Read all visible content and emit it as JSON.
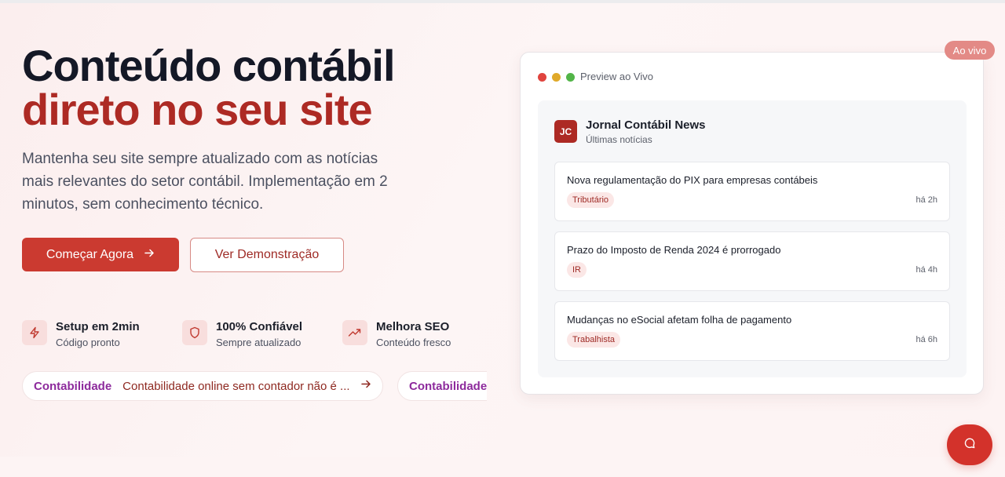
{
  "hero": {
    "title_line1": "Conteúdo contábil",
    "title_line2": "direto no seu site",
    "description": "Mantenha seu site sempre atualizado com as notícias mais relevantes do setor contábil. Implementação em 2 minutos, sem conhecimento técnico.",
    "primary_button": "Começar Agora",
    "secondary_button": "Ver Demonstração"
  },
  "features": [
    {
      "icon": "lightning-icon",
      "title": "Setup em 2min",
      "subtitle": "Código pronto"
    },
    {
      "icon": "shield-icon",
      "title": "100% Confiável",
      "subtitle": "Sempre atualizado"
    },
    {
      "icon": "trending-up-icon",
      "title": "Melhora SEO",
      "subtitle": "Conteúdo fresco"
    }
  ],
  "ticker": [
    {
      "category": "Contabilidade",
      "text": "Contabilidade online sem contador não é ..."
    },
    {
      "category": "Contabilidade",
      "text": ""
    }
  ],
  "preview": {
    "label": "Preview ao Vivo",
    "badge": "Ao vivo",
    "journal_initials": "JC",
    "journal_name": "Jornal Contábil News",
    "journal_subtitle": "Últimas notícias",
    "news": [
      {
        "title": "Nova regulamentação do PIX para empresas contábeis",
        "tag": "Tributário",
        "time": "há 2h"
      },
      {
        "title": "Prazo do Imposto de Renda 2024 é prorrogado",
        "tag": "IR",
        "time": "há 4h"
      },
      {
        "title": "Mudanças no eSocial afetam folha de pagamento",
        "tag": "Trabalhista",
        "time": "há 6h"
      }
    ]
  },
  "colors": {
    "accent": "#cb3a30",
    "brand_dark_red": "#ad2a24",
    "category_purple": "#8d2a9c",
    "window_dots": [
      "#e0443e",
      "#e0a92a",
      "#52b548"
    ]
  },
  "chat": {
    "icon": "chat-bubble-icon"
  }
}
